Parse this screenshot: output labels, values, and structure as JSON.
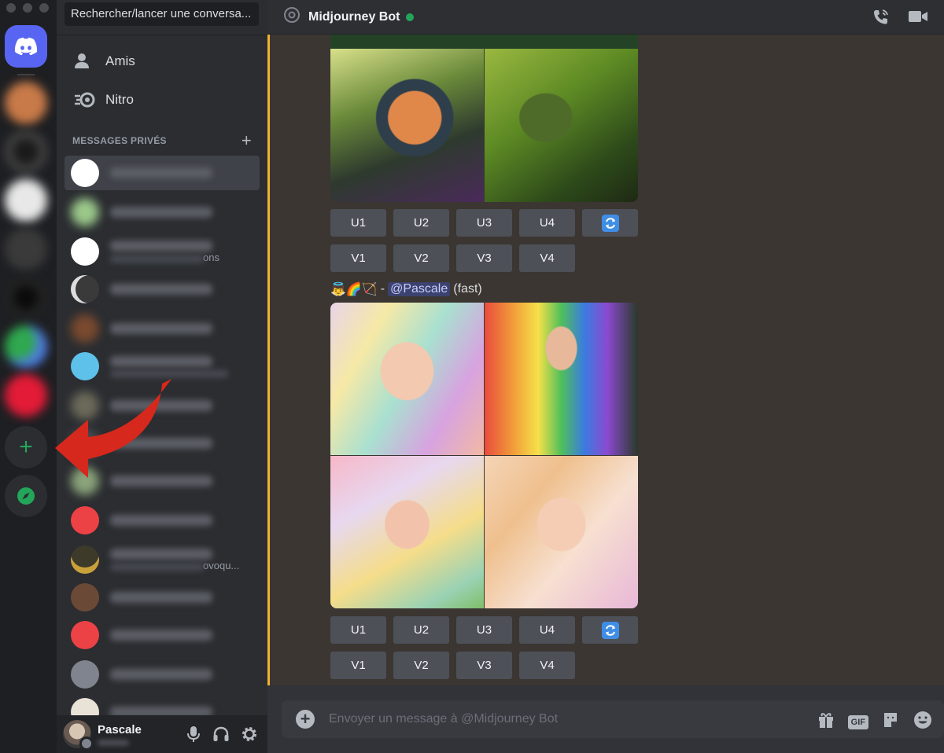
{
  "search": {
    "placeholder": "Rechercher/lancer une conversa..."
  },
  "nav": [
    {
      "label": "Amis",
      "icon": "friends-icon"
    },
    {
      "label": "Nitro",
      "icon": "nitro-icon"
    }
  ],
  "dm_section": {
    "title": "MESSAGES PRIVÉS",
    "add_icon": "plus-icon"
  },
  "dm_partial_texts": {
    "row3_sub": "ons",
    "row13_sub": "ovoqu..."
  },
  "header": {
    "at_icon": "@",
    "title": "Midjourney Bot",
    "status": "online"
  },
  "grid1": {
    "buttons_u": [
      "U1",
      "U2",
      "U3",
      "U4"
    ],
    "buttons_v": [
      "V1",
      "V2",
      "V3",
      "V4"
    ]
  },
  "message2": {
    "emoji": "👼🌈🏹",
    "separator": "-",
    "mention": "@Pascale",
    "mode": "(fast)"
  },
  "grid2": {
    "buttons_u": [
      "U1",
      "U2",
      "U3",
      "U4"
    ],
    "buttons_v": [
      "V1",
      "V2",
      "V3",
      "V4"
    ]
  },
  "composer": {
    "placeholder": "Envoyer un message à @Midjourney Bot",
    "gif_label": "GIF"
  },
  "user": {
    "name": "Pascale"
  },
  "colors": {
    "accent": "#5865f2",
    "online": "#23a55a",
    "highlight": "#f0b232",
    "arrow": "#d6281c"
  }
}
